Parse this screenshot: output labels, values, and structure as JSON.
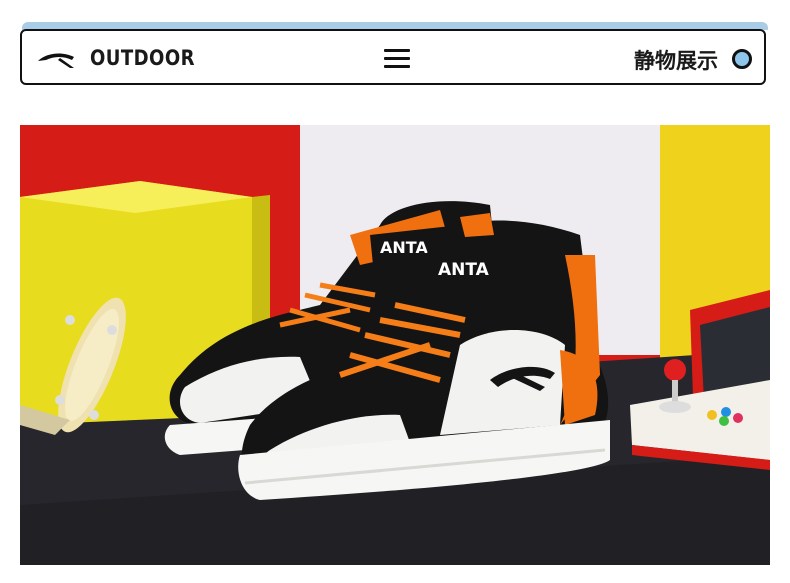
{
  "header": {
    "brand": "OUTDOOR",
    "section_title": "静物展示",
    "logo_icon": "anta-logo-icon",
    "menu_icon": "hamburger-menu-icon",
    "toggle_icon": "circle-toggle-icon"
  },
  "product": {
    "shoe_label": "ANTA",
    "tongue_label": "ANTA",
    "colors": {
      "black": "#141414",
      "white": "#f2f2f0",
      "orange": "#f07010",
      "wall_red": "#d51c16",
      "cube_yellow": "#efe020",
      "table": "#26262c"
    }
  }
}
